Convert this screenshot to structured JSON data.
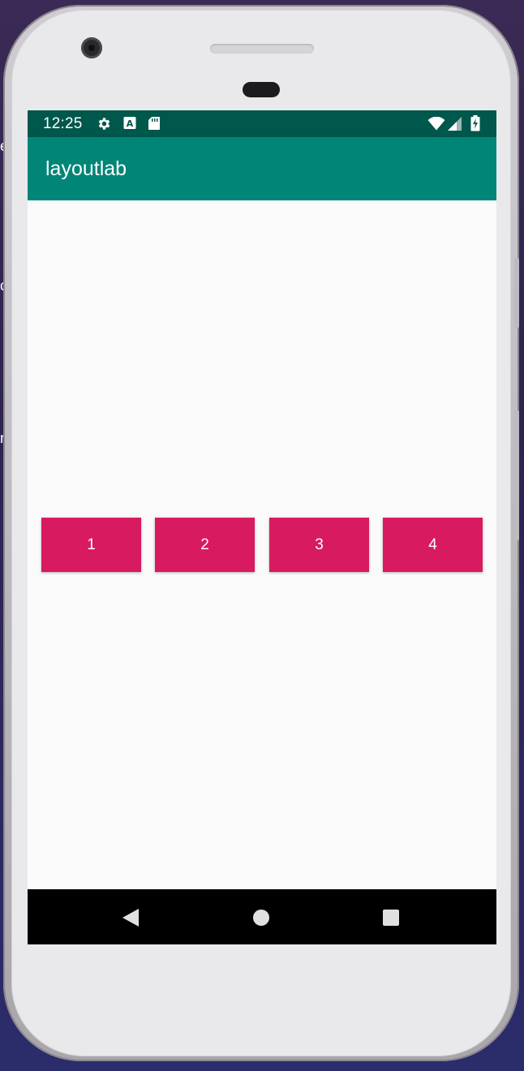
{
  "status_bar": {
    "time": "12:25",
    "left_icons": [
      "settings-icon",
      "a-keyboard-icon",
      "sd-card-icon"
    ],
    "right_icons": [
      "wifi-icon",
      "signal-icon",
      "battery-charging-icon"
    ],
    "color": "#00574b"
  },
  "app_bar": {
    "title": "layoutlab",
    "color": "#008577"
  },
  "buttons": [
    {
      "label": "1"
    },
    {
      "label": "2"
    },
    {
      "label": "3"
    },
    {
      "label": "4"
    }
  ],
  "button_color": "#d81b60",
  "nav_bar": {
    "items": [
      "back-icon",
      "home-icon",
      "recents-icon"
    ]
  }
}
